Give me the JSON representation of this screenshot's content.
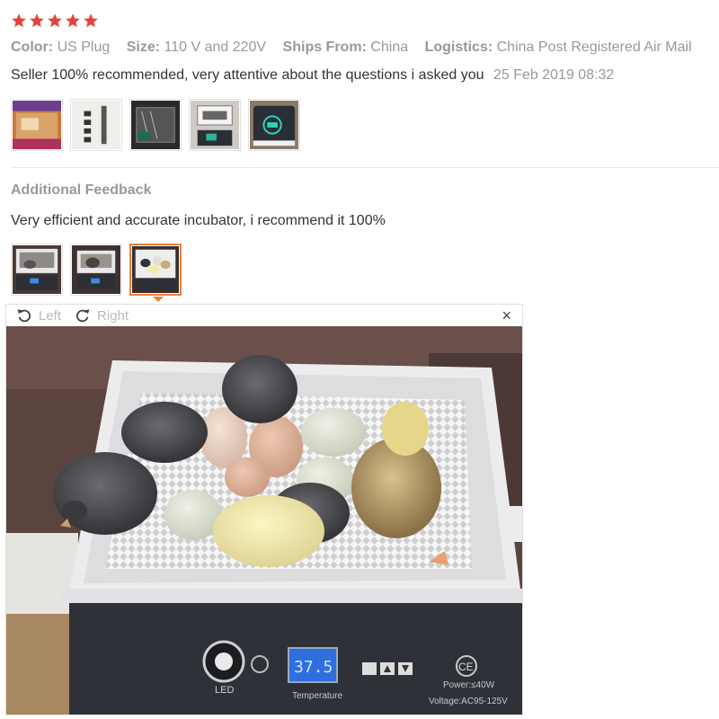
{
  "rating": {
    "stars": 5,
    "color": "#e8413a"
  },
  "meta": [
    {
      "label": "Color:",
      "value": "US Plug"
    },
    {
      "label": "Size:",
      "value": "110 V and 220V"
    },
    {
      "label": "Ships From:",
      "value": "China"
    },
    {
      "label": "Logistics:",
      "value": "China Post Registered Air Mail"
    }
  ],
  "review": {
    "text": "Seller 100% recommended, very attentive about the questions i asked you",
    "date": "25 Feb 2019 08:32"
  },
  "additional": {
    "heading": "Additional Feedback",
    "text": "Very efficient and accurate incubator, i recommend it 100%"
  },
  "viewer": {
    "left_label": "Left",
    "right_label": "Right",
    "close_glyph": "×",
    "accent": "#e8823a"
  },
  "incubator_display": {
    "led_label": "LED",
    "temperature_value": "37.5",
    "temperature_label": "Temperature",
    "power_label": "Power:≤40W",
    "voltage_label": "Voltage:AC95-125V",
    "ce_mark": "CE"
  }
}
